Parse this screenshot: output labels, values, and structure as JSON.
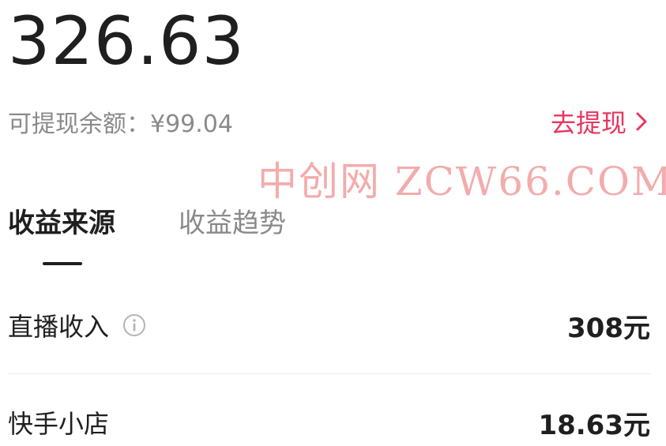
{
  "summary": {
    "total": "326.63",
    "balance_label": "可提现余额：¥99.04",
    "withdraw_label": "去提现"
  },
  "watermark": "中创网 ZCW66.COM",
  "tabs": [
    {
      "label": "收益来源",
      "active": true
    },
    {
      "label": "收益趋势",
      "active": false
    }
  ],
  "income_items": [
    {
      "label": "直播收入",
      "value": "308元",
      "has_info": true
    },
    {
      "label": "快手小店",
      "value": "18.63元",
      "has_info": false
    }
  ],
  "colors": {
    "accent": "#e8355f",
    "text": "#1f1f1f",
    "muted": "#8a8a8a",
    "watermark": "#f2a4a4"
  },
  "icons": {
    "withdraw_chevron": "chevron-right-icon",
    "info": "info-icon"
  }
}
